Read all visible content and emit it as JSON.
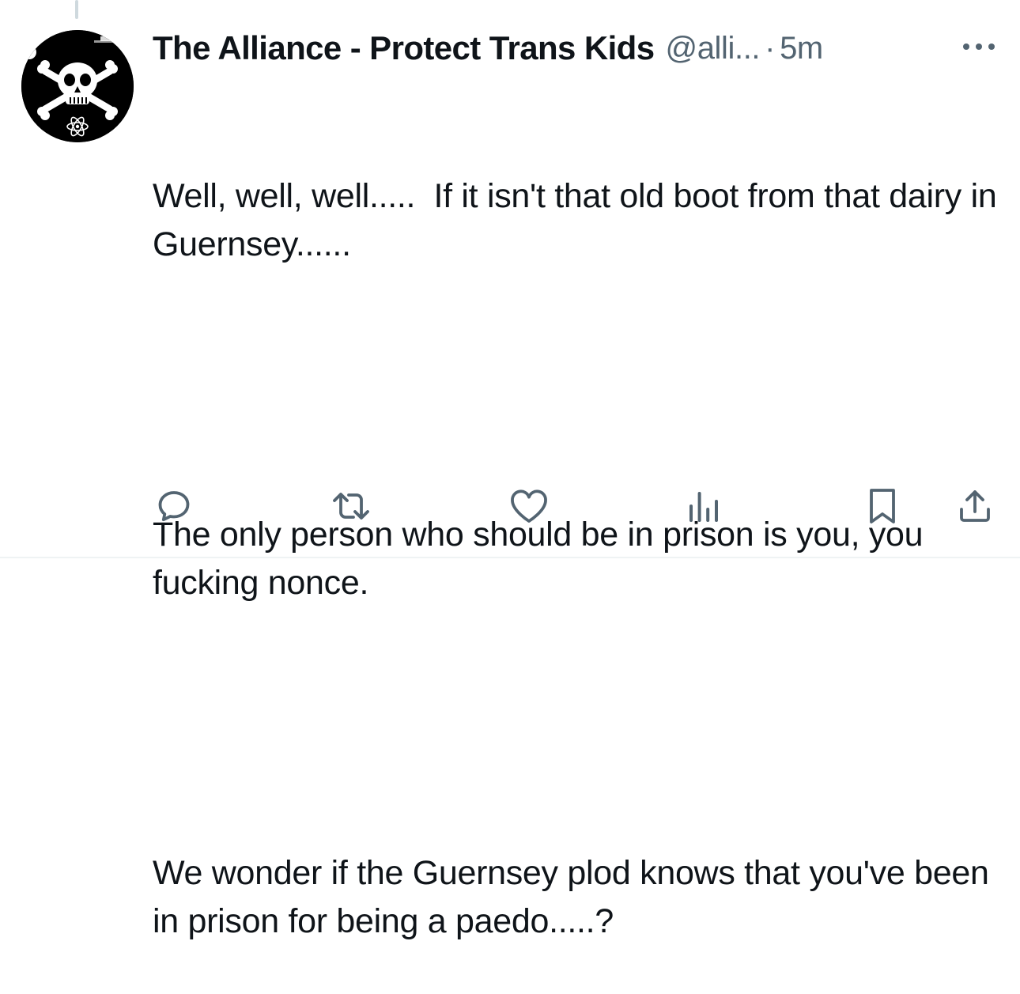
{
  "tweet": {
    "author": {
      "display_name": "The Alliance - Protect Trans Kids",
      "handle": "@alli...",
      "avatar_icon": "skull-crossbones-icon"
    },
    "separator": "·",
    "timestamp": "5m",
    "body": {
      "paragraphs": [
        "Well, well, well.....  If it isn't that old boot from that dairy in Guernsey......",
        "The only person who should be in prison is you, you fucking nonce.",
        "We wonder if the Guernsey plod knows that you've been in prison for being a paedo.....?"
      ]
    },
    "actions": [
      {
        "name": "reply",
        "icon": "reply-icon"
      },
      {
        "name": "retweet",
        "icon": "retweet-icon"
      },
      {
        "name": "like",
        "icon": "heart-icon"
      },
      {
        "name": "views",
        "icon": "analytics-icon"
      },
      {
        "name": "bookmark",
        "icon": "bookmark-icon"
      },
      {
        "name": "share",
        "icon": "share-icon"
      }
    ],
    "icon_color": "#536471"
  }
}
